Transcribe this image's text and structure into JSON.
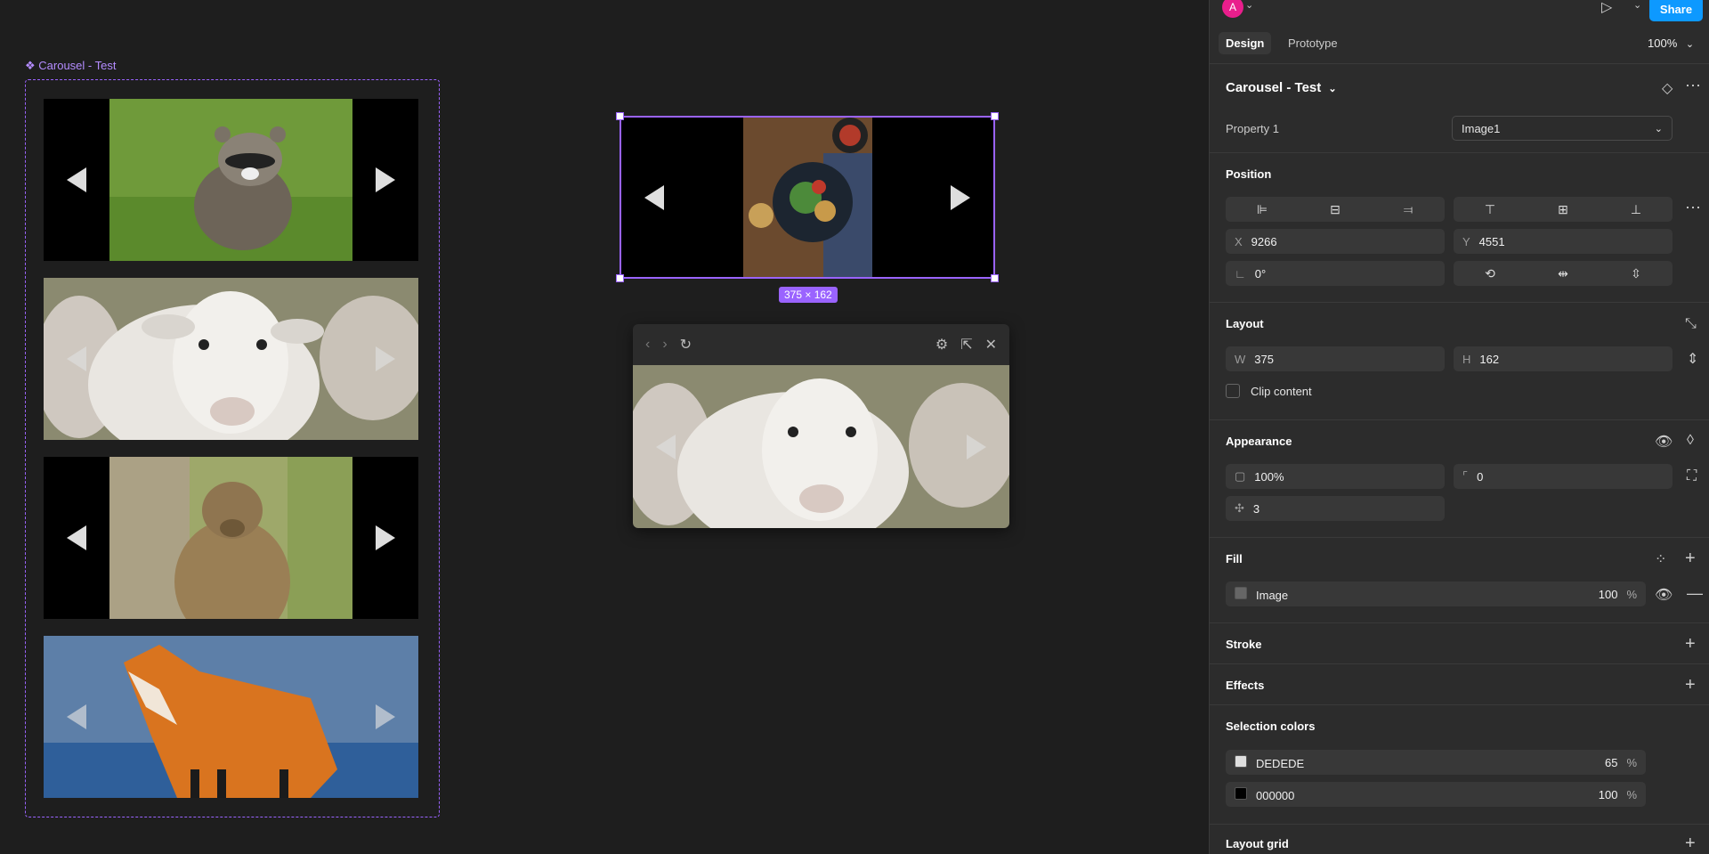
{
  "canvas": {
    "frame_label": "❖ Carousel - Test",
    "dimension_badge": "375 × 162"
  },
  "topbar": {
    "avatar_letter": "A",
    "share_label": "Share",
    "tabs": [
      "Design",
      "Prototype"
    ],
    "zoom": "100%"
  },
  "component": {
    "name": "Carousel - Test",
    "property_label": "Property 1",
    "property_value": "Image1"
  },
  "position": {
    "title": "Position",
    "x_label": "X",
    "x": "9266",
    "y_label": "Y",
    "y": "4551",
    "rotation": "0°"
  },
  "layout": {
    "title": "Layout",
    "w_label": "W",
    "w": "375",
    "h_label": "H",
    "h": "162",
    "clip_label": "Clip content"
  },
  "appearance": {
    "title": "Appearance",
    "opacity": "100%",
    "radius": "0",
    "blur": "3"
  },
  "fill": {
    "title": "Fill",
    "type": "Image",
    "opacity": "100",
    "pct": "%"
  },
  "stroke_title": "Stroke",
  "effects_title": "Effects",
  "selection_colors": {
    "title": "Selection colors",
    "items": [
      {
        "hex": "DEDEDE",
        "opacity": "65",
        "pct": "%"
      },
      {
        "hex": "000000",
        "opacity": "100",
        "pct": "%"
      }
    ]
  },
  "layout_grid_title": "Layout grid",
  "colors": {
    "accent": "#9a63ff",
    "share": "#0d99ff",
    "avatar": "#e91e8c"
  }
}
